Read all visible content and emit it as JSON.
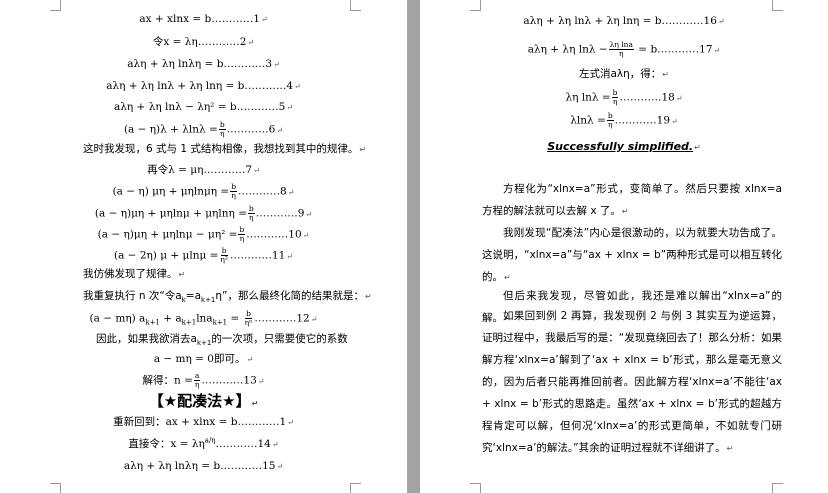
{
  "left": {
    "eq1": "ax + xlnx = b",
    "eq1_num": "…………1",
    "eq2": "令x = λη",
    "eq2_num": "…………2",
    "eq3": "aλη + λη lnλη = b",
    "eq3_num": "…………3",
    "eq4": "aλη + λη lnλ + λη lnη = b",
    "eq4_num": "…………4",
    "eq5": "aλη + λη lnλ − λη² = b",
    "eq5_num": "…………5",
    "eq6_left": "(a − η)λ + λlnλ =",
    "eq6_num": "…………6",
    "discovery": "这时我发现，6 式与 1 式结构相像，我想找到其中的规律。",
    "eq7": "再令λ = μη",
    "eq7_num": "…………7",
    "eq8_left": "(a − η) μη + μηlnμη =",
    "eq8_num": "…………8",
    "eq9_left": "(a − η)μη + μηlnμ + μηlnη =",
    "eq9_num": "…………9",
    "eq10_left": "(a − η)μη + μηlnμ − μη² =",
    "eq10_num": "…………10",
    "eq11_left": "(a − 2η) μ + μlnμ =",
    "eq11_num": "…………11",
    "pattern": "我仿佛发现了规律。",
    "repeat": "我重复执行 n 次“令a",
    "repeat_tail": "”，那么最终化简的结果就是：",
    "eq12_left": "(a − mη) a",
    "eq12_num": "…………12",
    "eliminate": "因此，如果我欲消去a",
    "eliminate_tail": "的一次项，只需要使它的系数",
    "eq_zero": "a − mη = 0即可。",
    "solve": "解得：n =",
    "solve_num": "…………13",
    "heading": "【★配凑法★】",
    "back": "重新回到：ax + xlnx = b",
    "back_num": "…………1",
    "direct": "直接令：x = λη",
    "direct_num": "…………14",
    "eq15": "aλη  + λη lnλη  = b",
    "eq15_num": "…………15"
  },
  "right": {
    "eq16": "aλη  + λη lnλ + λη lnη  = b",
    "eq16_num": "…………16",
    "eq17_left": "aλη  + λη lnλ −",
    "eq17_num": "…………17",
    "cancel": "左式消aλη，得：",
    "eq18": "λη lnλ =",
    "eq18_num": "…………18",
    "eq19": "λlnλ =",
    "eq19_num": "…………19",
    "simplified": "Successfully simplified.",
    "p1": "方程化为“xlnx=a”形式，变简单了。然后只要按 xlnx=a 方程的解法就可以去解 x 了。",
    "p2": "我刚发现“配凑法”内心是很激动的，以为就要大功告成了。这说明，“xlnx=a”与“ax + xlnx = b”两种形式是可以相互转化的。",
    "p3": "但后来我发现，尽管如此，我还是难以解出“xlnx=a”的解。",
    "p4": "如果回到例 2 再算，我发现例 2 与例 3 其实互为逆运算，证明过程中，我最后写的是：“发现竟绕回去了！那么分析：如果解方程‘xlnx=a’解到了‘ax + xlnx = b’形式，那么是毫无意义的，因为后者只能再推回前者。因此解方程‘xlnx=a’不能往‘ax + xlnx = b’形式的思路走。虽然‘ax + xlnx = b’形式的超越方程肯定可以解，但何况‘xlnx=a’的形式更简单，不如就专门研究‘xlnx=a’的解法。”其余的证明过程就不详细讲了。"
  }
}
